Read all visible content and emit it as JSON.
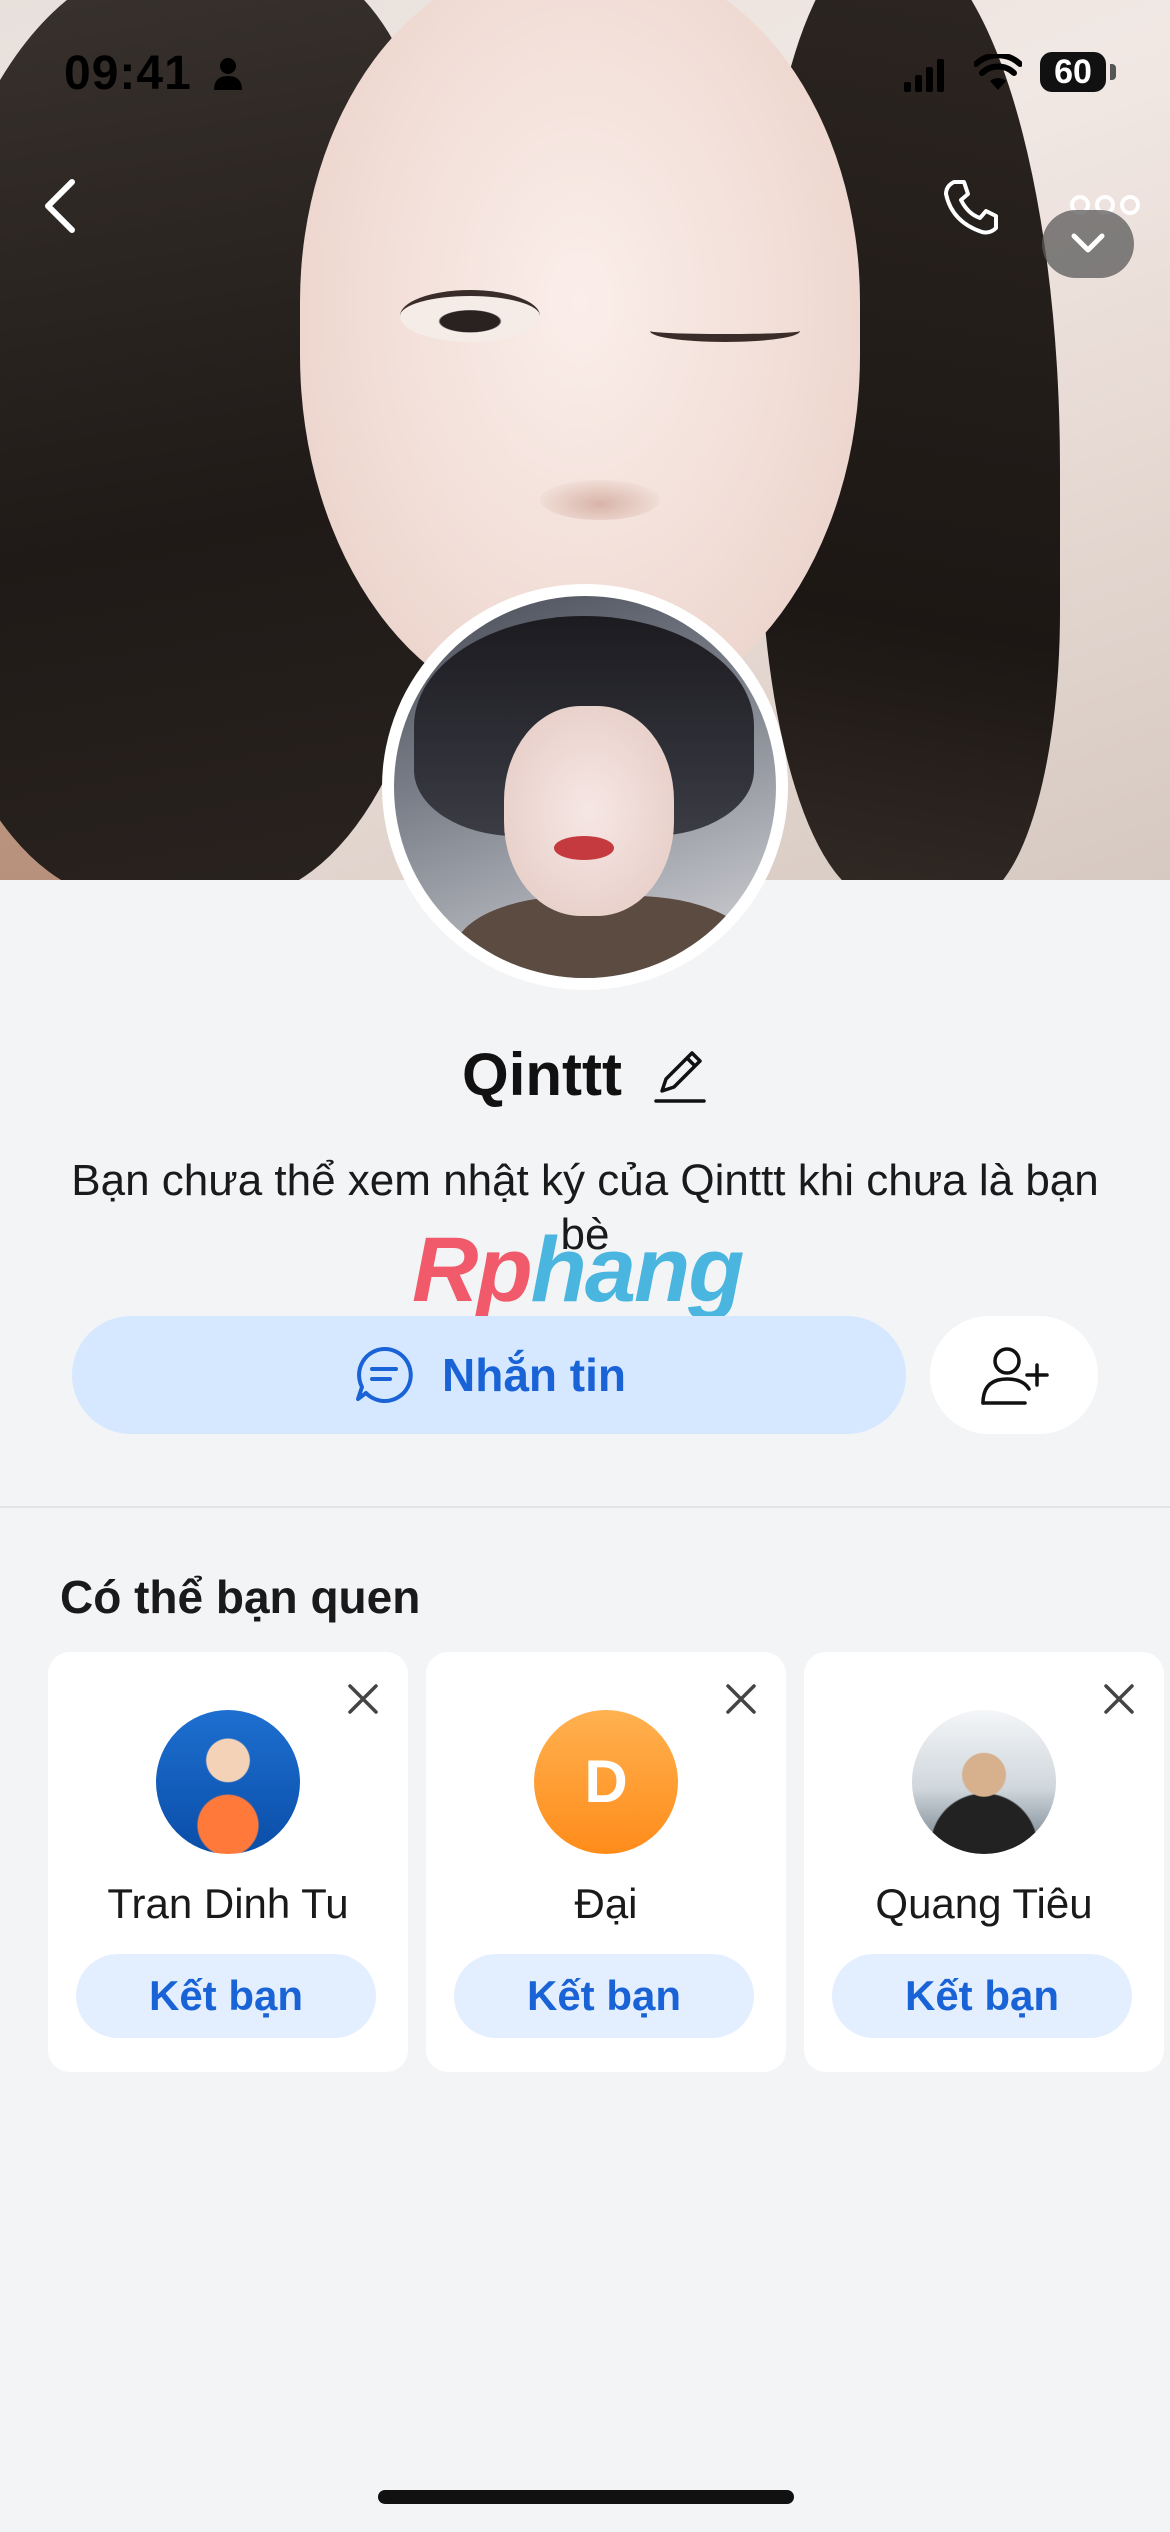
{
  "status_bar": {
    "time": "09:41",
    "battery": "60"
  },
  "profile": {
    "name": "Qinttt",
    "description": "Bạn chưa thể xem nhật ký của Qinttt khi chưa là bạn bè",
    "message_button": "Nhắn tin"
  },
  "watermark": {
    "part1": "Rp",
    "part2": "hang"
  },
  "suggestions": {
    "title": "Có thể bạn quen",
    "items": [
      {
        "name": "Tran Dinh Tu",
        "button": "Kết bạn",
        "avatar": "photo"
      },
      {
        "name": "Đại",
        "button": "Kết bạn",
        "avatar_letter": "D"
      },
      {
        "name": "Quang Tiêu",
        "button": "Kết bạn",
        "avatar": "photo"
      }
    ]
  },
  "colors": {
    "accent": "#1a63d6",
    "message_button_bg": "#d6e8ff",
    "add_friend_bg": "#e3efff",
    "page_bg": "#f3f4f6"
  },
  "icons": [
    "back-icon",
    "phone-icon",
    "more-icon",
    "chevron-down-icon",
    "edit-icon",
    "chat-icon",
    "add-friend-icon",
    "close-icon"
  ]
}
